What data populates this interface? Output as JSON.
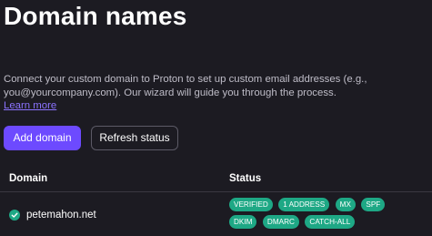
{
  "page": {
    "title": "Domain names",
    "description_line1": "Connect your custom domain to Proton to set up custom email addresses (e.g.,",
    "description_line2": "you@yourcompany.com). Our wizard will guide you through the process.",
    "learn_more": "Learn more"
  },
  "actions": {
    "add_domain": "Add domain",
    "refresh_status": "Refresh status"
  },
  "table": {
    "columns": {
      "domain": "Domain",
      "status": "Status"
    },
    "rows": [
      {
        "domain": "petemahon.net",
        "status_icon": "check-circle-icon",
        "badges": [
          "VERIFIED",
          "1 ADDRESS",
          "MX",
          "SPF",
          "DKIM",
          "DMARC",
          "CATCH-ALL"
        ]
      }
    ]
  },
  "colors": {
    "background": "#1c1b22",
    "accent": "#6d4aff",
    "link": "#8b73ff",
    "success": "#1ea885"
  }
}
